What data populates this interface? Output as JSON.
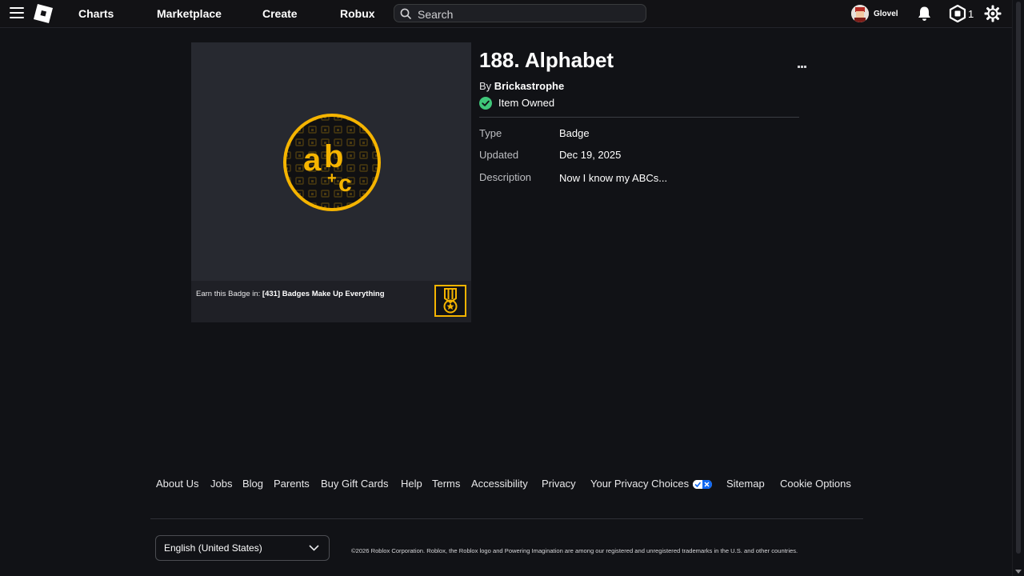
{
  "nav": {
    "links": [
      "Charts",
      "Marketplace",
      "Create",
      "Robux"
    ],
    "search_placeholder": "Search",
    "username": "Glovel",
    "robux_count": "1"
  },
  "item": {
    "title": "188. Alphabet",
    "by_prefix": "By",
    "creator": "Brickastrophe",
    "owned_label": "Item Owned",
    "details": [
      {
        "label": "Type",
        "value": "Badge"
      },
      {
        "label": "Updated",
        "value": "Dec 19, 2025"
      },
      {
        "label": "Description",
        "value": "Now I know my ABCs..."
      }
    ],
    "earn_prefix": "Earn this Badge in:",
    "earn_experience": "[431] Badges Make Up Everything",
    "badge_art_text": {
      "a": "a",
      "b": "b",
      "plus": "+",
      "c": "c"
    }
  },
  "footer": {
    "links": [
      "About Us",
      "Jobs",
      "Blog",
      "Parents",
      "Buy Gift Cards",
      "Help",
      "Terms",
      "Accessibility",
      "Privacy",
      "Your Privacy Choices",
      "Sitemap",
      "Cookie Options"
    ],
    "language": "English (United States)",
    "copyright": "©2026 Roblox Corporation. Roblox, the Roblox logo and Powering Imagination are among our registered and unregistered trademarks in the U.S. and other countries."
  },
  "colors": {
    "background": "#111216",
    "panel": "#272930",
    "badge_gold": "#f5b400",
    "owned_green": "#3fc679",
    "privacy_blue": "#1068f2"
  }
}
